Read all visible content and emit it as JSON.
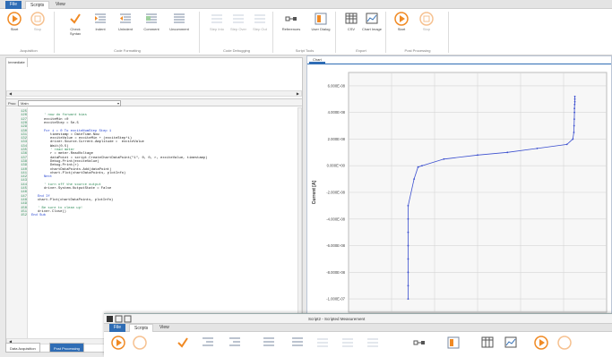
{
  "tabs": {
    "file": "File",
    "scripts": "Scripts",
    "view": "View"
  },
  "ribbon": {
    "start": "Start",
    "stop": "Stop",
    "check_syntax": "Check Syntax",
    "indent": "Indent",
    "unindent": "Unindent",
    "comment": "Comment",
    "uncomment": "Uncomment",
    "step_into": "Step Into",
    "step_over": "Step Over",
    "step_out": "Step Out",
    "references": "References",
    "user_dialog": "User Dialog",
    "csv": "CSV",
    "chart_image": "Chart Image",
    "pp_start": "Start",
    "pp_stop": "Stop",
    "groups": {
      "acquisition": "Acquisition",
      "formatting": "Code Formatting",
      "debugging": "Code Debugging",
      "tools": "Script Tools",
      "export": "Export",
      "post": "Post Processing"
    },
    "colors": {
      "accent": "#2f6db5",
      "orange": "#f08a24"
    }
  },
  "left": {
    "immediate": "Immediate",
    "proc_label": "Proc:",
    "proc_value": "Main",
    "bottom_tabs": [
      "Data Acquisition",
      "Post Processing"
    ]
  },
  "code": {
    "line_numbers": [
      "125",
      "126",
      "127",
      "128",
      "129",
      "130",
      "131",
      "132",
      "133",
      "134",
      "135",
      "136",
      "137",
      "138",
      "139",
      "140",
      "141",
      "142",
      "143",
      "144",
      "145",
      "146",
      "147",
      "148",
      "149",
      "150",
      "151",
      "152"
    ],
    "lines": [
      {
        "t": "",
        "c": ""
      },
      {
        "t": "' now do forward bias",
        "c": "cm",
        "i": 2
      },
      {
        "t": "exciteMin =0",
        "c": "",
        "i": 2
      },
      {
        "t": "exciteStep = 5e-5",
        "c": "",
        "i": 2
      },
      {
        "t": "",
        "c": ""
      },
      {
        "t": "For i = 0 To exciteNumStep Step 1",
        "c": "kw",
        "i": 2
      },
      {
        "t": "timestamp = DateTime.Now",
        "c": "",
        "i": 3
      },
      {
        "t": "exciteValue = exciteMin + (exciteStep*i)",
        "c": "",
        "i": 3
      },
      {
        "t": "driver.Source.Current.Amplitude =  exciteValue",
        "c": "",
        "i": 3
      },
      {
        "t": "Wait(0.5)",
        "c": "",
        "i": 3
      },
      {
        "t": "' read meter",
        "c": "cm",
        "i": 3
      },
      {
        "t": "r = meter.ReadVoltage",
        "c": "",
        "i": 3
      },
      {
        "t": "dataPoint = script.CreateChartDataPoint(\"1\", 0, 0, r, exciteValue, timestamp)",
        "c": "",
        "i": 3
      },
      {
        "t": "Debug.Print(exciteValue)",
        "c": "",
        "i": 3
      },
      {
        "t": "Debug.Print(r)",
        "c": "",
        "i": 3
      },
      {
        "t": "chartDataPoints.Add(dataPoint)",
        "c": "",
        "i": 3
      },
      {
        "t": "chart.Plot(chartDataPoints, plotInfo)",
        "c": "",
        "i": 3
      },
      {
        "t": "Next",
        "c": "kw",
        "i": 2
      },
      {
        "t": "",
        "c": ""
      },
      {
        "t": "' turn off the source output",
        "c": "cm",
        "i": 2
      },
      {
        "t": "driver.System.OutputState = False",
        "c": "",
        "i": 2
      },
      {
        "t": "",
        "c": ""
      },
      {
        "t": "End If",
        "c": "kw",
        "i": 1
      },
      {
        "t": "chart.Plot(chartDataPoints, plotInfo)",
        "c": "",
        "i": 1
      },
      {
        "t": "",
        "c": ""
      },
      {
        "t": "' Be sure to clean up!",
        "c": "cm",
        "i": 1
      },
      {
        "t": "driver.Close()",
        "c": "",
        "i": 1
      },
      {
        "t": "End Sub",
        "c": "kw",
        "i": 0
      }
    ]
  },
  "chart_tab": "Chart",
  "chart_data": {
    "type": "line",
    "ylabel": "Current [A]",
    "xlabel": "",
    "ylim": [
      -1.1e-07,
      7e-08
    ],
    "yticks": [
      "6.000E-08",
      "4.000E-08",
      "2.000E-08",
      "0.000E+00",
      "-2.000E-08",
      "-4.000E-08",
      "-6.000E-08",
      "-8.000E-08",
      "-1.000E-07"
    ],
    "ytick_values": [
      6e-08,
      4e-08,
      2e-08,
      0,
      -2e-08,
      -4e-08,
      -6e-08,
      -8e-08,
      -1e-07
    ],
    "grid": true,
    "x": [
      0.0,
      0.0,
      0.0,
      0.0,
      0.0,
      0.0,
      0.0,
      0.0,
      0.3,
      0.5,
      0.7,
      1.8,
      3.5,
      5.0,
      6.5,
      8.0,
      8.3,
      8.35,
      8.36,
      8.37,
      8.38,
      8.38,
      8.39,
      8.4,
      8.4,
      8.4
    ],
    "values": [
      -1e-07,
      -9e-08,
      -8e-08,
      -7e-08,
      -6e-08,
      -5e-08,
      -4e-08,
      -3e-08,
      -1e-08,
      -1e-09,
      0.0,
      5e-09,
      8e-09,
      1e-08,
      1.3e-08,
      1.6e-08,
      2e-08,
      2.5e-08,
      3e-08,
      3.5e-08,
      4e-08,
      4.3e-08,
      4.6e-08,
      4.8e-08,
      5e-08,
      5.2e-08
    ],
    "color": "#3b4fcf"
  },
  "window2": {
    "title": "Script2 - Scripted Measurement",
    "tabs": [
      "File",
      "Scripts",
      "View"
    ]
  }
}
